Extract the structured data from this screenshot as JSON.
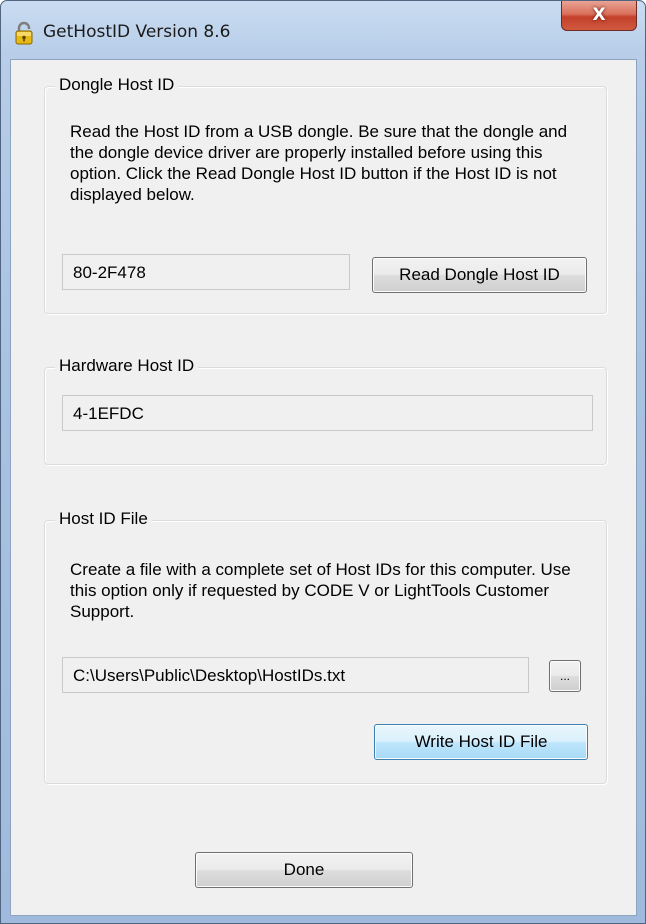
{
  "window": {
    "title": "GetHostID Version 8.6",
    "icon": "padlock-icon",
    "close_label": "X"
  },
  "dongle": {
    "legend": "Dongle Host ID",
    "description": "Read the Host ID from a USB dongle.  Be sure that the dongle and the dongle device driver are properly installed before using this option.  Click the Read Dongle Host ID button if the Host ID is not displayed below.",
    "host_id": "80-2F478",
    "read_button": "Read Dongle Host ID"
  },
  "hardware": {
    "legend": "Hardware Host ID",
    "host_id": "4-1EFDC"
  },
  "file": {
    "legend": "Host ID File",
    "description": "Create a file with a complete set of Host IDs for this computer. Use this option only if requested by CODE V or LightTools Customer Support.",
    "path": "C:\\Users\\Public\\Desktop\\HostIDs.txt",
    "browse_button": "...",
    "write_button": "Write Host ID File"
  },
  "done_button": "Done",
  "colors": {
    "dialog_background": "#f0f0f0",
    "frame": "#a9c2e2",
    "close_button": "#c4402a"
  }
}
